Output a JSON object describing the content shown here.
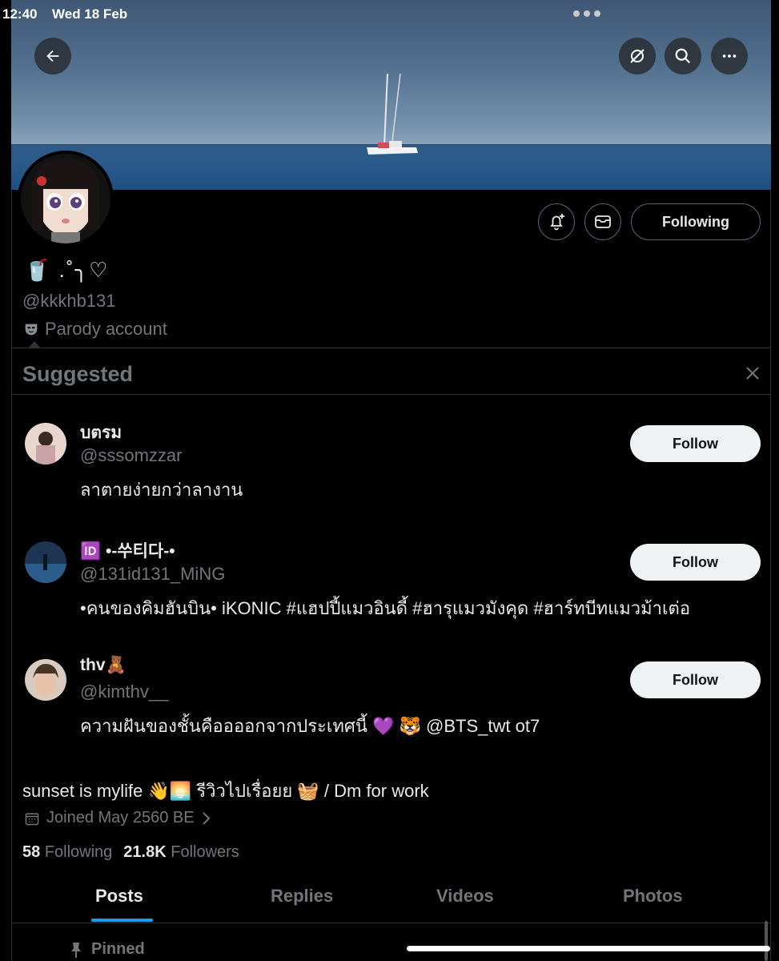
{
  "status_bar": {
    "time": "12:40",
    "date": "Wed 18 Feb"
  },
  "header_icons": {
    "back": "back-arrow-icon",
    "grok": "grok-icon",
    "search": "search-icon",
    "more": "more-icon"
  },
  "profile": {
    "display_name": "🥤 .˚╮♡",
    "handle": "@kkkhb131",
    "parody_label": "Parody account",
    "follow_state": "Following",
    "bio": "sunset is mylife 👋🌅 รีวิวไปเรื่อยย 🧺 / Dm for work",
    "joined": "Joined May 2560 BE",
    "following_count": "58",
    "following_label": "Following",
    "followers_count": "21.8K",
    "followers_label": "Followers"
  },
  "suggested": {
    "title": "Suggested",
    "follow_label": "Follow",
    "items": [
      {
        "name": "บตรม",
        "handle": "@sssomzzar",
        "bio": "ลาตายง่ายกว่าลางาน"
      },
      {
        "name": "🆔 •-쑤티다-•",
        "handle": "@131id131_MiNG",
        "bio": "•คนของคิมฮันบิน• iKONIC #แฮปปี้แมวอินดี้ #ฮารุแมวมังคุด #ฮาร์ทบีทแมวม้าเต่อ"
      },
      {
        "name": "thv🧸",
        "handle": "@kimthv__",
        "bio": "ความฝันของชั้นคืออออกจากประเทศนี้ 💜 🐯 @BTS_twt ot7"
      }
    ]
  },
  "tabs": [
    "Posts",
    "Replies",
    "Videos",
    "Photos"
  ],
  "active_tab": "Posts",
  "pinned_label": "Pinned",
  "colors": {
    "accent": "#1d9bf0",
    "background": "#000000",
    "muted": "#71767b"
  }
}
